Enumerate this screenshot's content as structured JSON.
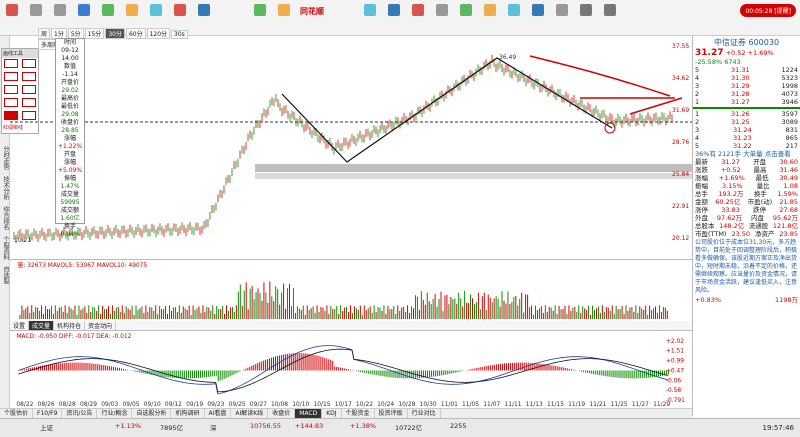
{
  "toolbar": {
    "brand": "同花顺",
    "badge": "00:05:28 [提醒]",
    "labels": [
      "",
      "",
      "",
      "",
      "",
      "",
      "",
      "",
      ""
    ]
  },
  "left_tabs": [
    "分时走势",
    "技术分析",
    "综合排名",
    "个股资料",
    "自选股"
  ],
  "draw_panel": {
    "title": "画线工具",
    "footer": "红绿柳线"
  },
  "periods": [
    "周",
    "1分",
    "5分",
    "15分",
    "30分",
    "60分",
    "120分",
    "30s",
    "多周期",
    "设置"
  ],
  "info_box": {
    "labels": [
      "时间",
      "09-12",
      "14:00",
      "数值",
      "-1.14",
      "开盘价",
      "最高价",
      "最低价",
      "收盘价",
      "涨幅",
      "开盘",
      "涨幅",
      "振幅",
      "成交量",
      "成交额",
      "换手"
    ],
    "values": [
      "",
      "",
      "",
      "",
      "",
      "29.02",
      "",
      "29.08",
      "28.85",
      "+1.22%",
      "",
      "+5.09%",
      "1.47%",
      "59995",
      "1.60亿",
      "0.04%"
    ]
  },
  "main_axis": [
    "37.55",
    "34.62",
    "31.69",
    "28.76",
    "25.84",
    "22.91",
    "20.12"
  ],
  "main_labels": {
    "high": "36.49",
    "low": "10.21"
  },
  "vol_legend": "量: 32673  MAVOL5: 53067  MAVOL10: 49075",
  "macd_legend": "MACD: -0.050  DIFF: -0.017  DEA: -0.012",
  "macd_axis": [
    "+2.02",
    "+1.51",
    "+0.99",
    "+0.47",
    "-0.06",
    "-0.58",
    "-0.791"
  ],
  "vol_tabs": [
    "设置",
    "成交量",
    "机构持仓",
    "资金动向"
  ],
  "x_dates": [
    "08/22",
    "08/26",
    "08/28",
    "08/29",
    "09/03",
    "09/05",
    "09/10",
    "09/12",
    "09/19",
    "09/23",
    "09/25",
    "09/27",
    "10/08",
    "10/10",
    "10/15",
    "10/17",
    "10/22",
    "10/24",
    "10/28",
    "10/30",
    "11/01",
    "11/05",
    "11/07",
    "11/11",
    "11/13",
    "11/15",
    "11/19",
    "11/21",
    "11/25",
    "11/27",
    "11/29"
  ],
  "bottom_tabs": [
    "个股估价",
    "F10/F9",
    "资讯/公告",
    "行业/概念",
    "自选股分析",
    "机构调研",
    "AI看盘",
    "AI解读K线",
    "收盘价",
    "MACD",
    "KDJ",
    "个股资金",
    "投资评级",
    "行业对比"
  ],
  "right_panel": {
    "name": "中信证券 600030",
    "price": "31.27",
    "change": "+0.52",
    "pct": "+1.69%",
    "sub": "-25.58%  6743",
    "asks": [
      [
        "5",
        "31.31",
        "1224"
      ],
      [
        "4",
        "31.30",
        "5323"
      ],
      [
        "3",
        "31.29",
        "1998"
      ],
      [
        "2",
        "31.28",
        "4073"
      ],
      [
        "1",
        "31.27",
        "3946"
      ]
    ],
    "bids": [
      [
        "1",
        "31.26",
        "3597"
      ],
      [
        "2",
        "31.25",
        "3089"
      ],
      [
        "3",
        "31.24",
        "831"
      ],
      [
        "4",
        "31.23",
        "865"
      ],
      [
        "5",
        "31.22",
        "217"
      ]
    ],
    "order_book_side_ask": "卖",
    "order_book_side_bid": "买",
    "summary": "36%有 2121手  大单量  点击查看",
    "stats": [
      [
        "最新",
        "31.27",
        "开盘",
        "30.60"
      ],
      [
        "涨跌",
        "+0.52",
        "最高",
        "31.46"
      ],
      [
        "涨幅",
        "+1.69%",
        "最低",
        "30.49"
      ],
      [
        "振幅",
        "3.15%",
        "量比",
        "1.08"
      ],
      [
        "总手",
        "193.2万",
        "换手",
        "1.59%"
      ],
      [
        "金额",
        "60.25亿",
        "市盈(动)",
        "21.85"
      ],
      [
        "涨停",
        "33.83",
        "跌停",
        "27.68"
      ],
      [
        "外盘",
        "97.62万",
        "内盘",
        "95.62万"
      ],
      [
        "总股本",
        "148.2亿",
        "流通股",
        "121.8亿"
      ],
      [
        "市盈(TTM)",
        "23.50",
        "净资产",
        "23.85"
      ]
    ],
    "note": "公司股价位于成本位31.30元，多方趋势中，目前处于回调整理阶段后，积极看多做确保。该股近期方案正及净出货中，短时期未稳，沿着不定的价格，还需继续观察。应当量价及资金情况，请于市场资金活跃，建议逢低买入，注意风险。",
    "footer_nums": [
      "+0.83%",
      "1198万"
    ]
  },
  "status": {
    "items": [
      "上证",
      "+1.13%",
      "7895亿",
      "深",
      "10756.55",
      "+144.83",
      "+1.38%",
      "10722亿",
      "2255"
    ],
    "clock": "19:57:46"
  },
  "colors": {
    "up": "#d40000",
    "down": "#0a8a00",
    "brand": "#d40000",
    "macd_line": "#1a3aa8"
  }
}
